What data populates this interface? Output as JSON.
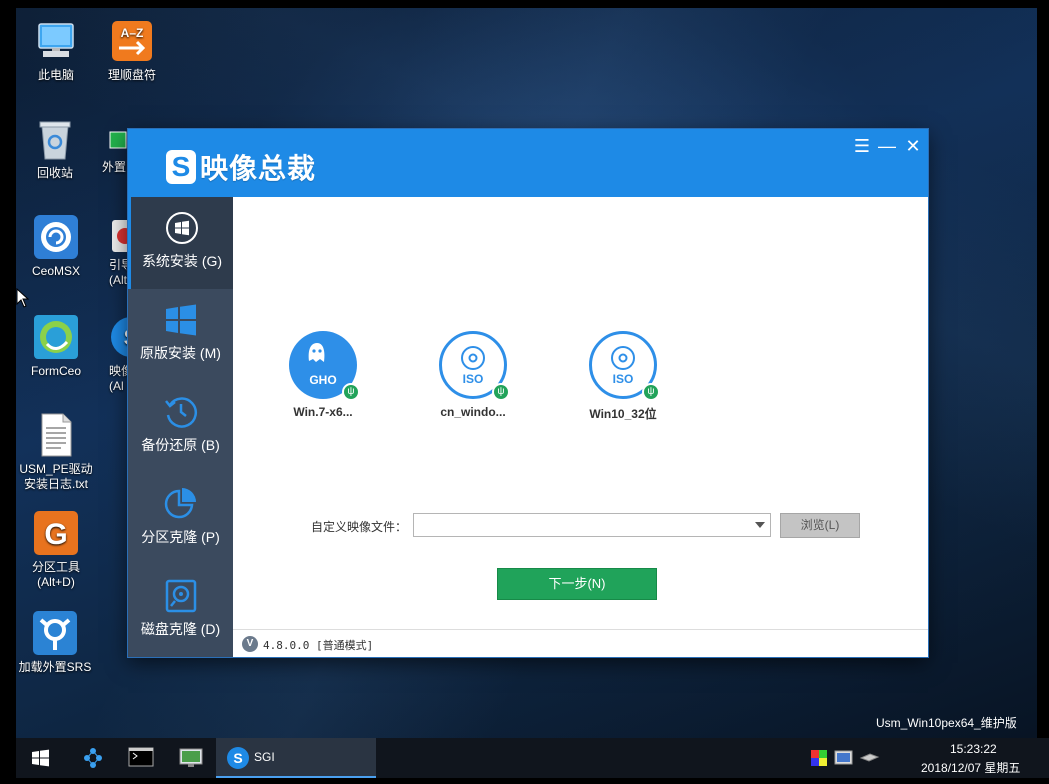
{
  "desktop": {
    "icons": [
      {
        "label": "此电脑"
      },
      {
        "label": "理顺盘符"
      },
      {
        "label": "回收站"
      },
      {
        "label": "外置"
      },
      {
        "label": "CeoMSX"
      },
      {
        "label": "引导\n(Alt"
      },
      {
        "label": "FormCeo"
      },
      {
        "label": "映像\n(Al"
      },
      {
        "label": "USM_PE驱动\n安装日志.txt"
      },
      {
        "label": "分区工具\n(Alt+D)"
      },
      {
        "label": "加载外置SRS"
      }
    ],
    "watermark": "Usm_Win10pex64_维护版"
  },
  "window": {
    "title": "映像总裁",
    "logo_letter": "S",
    "controls": {
      "menu": "☰",
      "minimize": "—",
      "close": "✕"
    },
    "sidebar": [
      {
        "label": "系统安装 (G)"
      },
      {
        "label": "原版安装 (M)"
      },
      {
        "label": "备份还原 (B)"
      },
      {
        "label": "分区克隆 (P)"
      },
      {
        "label": "磁盘克隆 (D)"
      }
    ],
    "images": [
      {
        "badge": "GHO",
        "name": "Win.7-x6..."
      },
      {
        "badge": "ISO",
        "name": "cn_windo..."
      },
      {
        "badge": "ISO",
        "name": "Win10_32位"
      }
    ],
    "custom_label": "自定义映像文件：",
    "custom_value": "",
    "browse_label": "浏览(L)",
    "next_label": "下一步(N)",
    "version_icon": "V",
    "version_text": "4.8.0.0 [普通模式]"
  },
  "taskbar": {
    "active_app": "SGI",
    "clock_time": "15:23:22",
    "clock_date": "2018/12/07 星期五"
  },
  "colors": {
    "accent": "#1e8ae6",
    "sidebar": "#3b4a5e",
    "green": "#20a35a"
  }
}
